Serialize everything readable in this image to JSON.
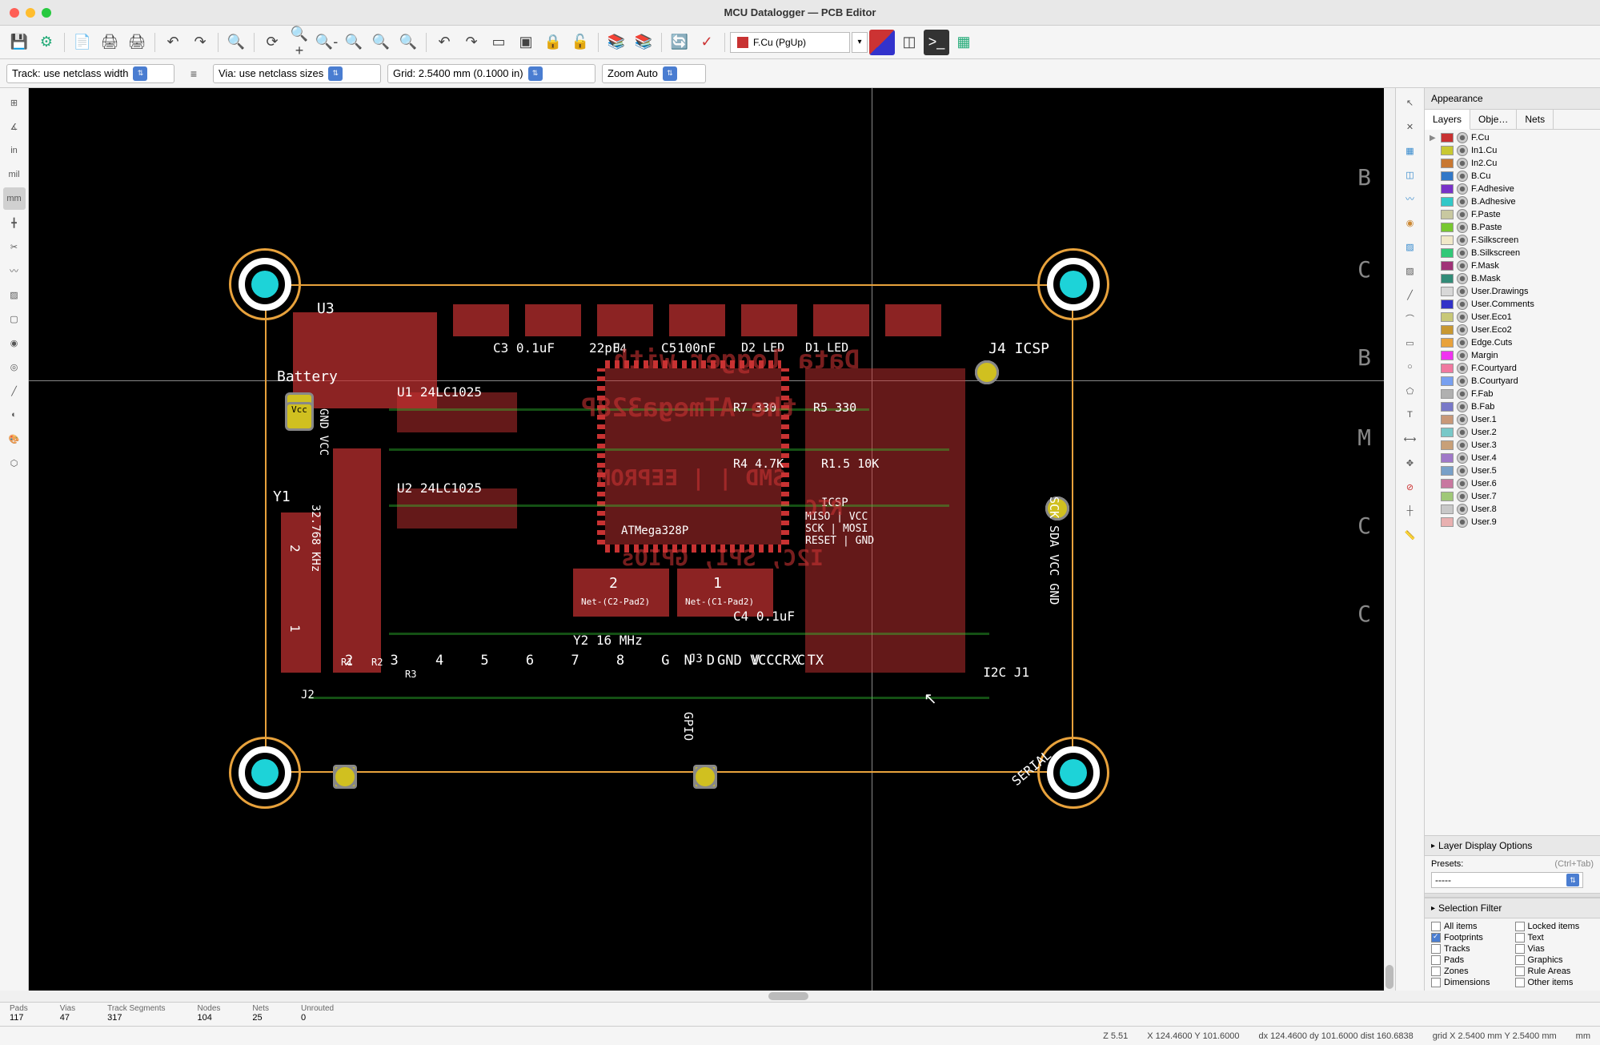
{
  "window": {
    "title": "MCU Datalogger — PCB Editor"
  },
  "toolbar": {
    "layer_selector": "F.Cu (PgUp)"
  },
  "toolbar2": {
    "track": "Track: use netclass width",
    "via": "Via: use netclass sizes",
    "grid": "Grid: 2.5400 mm (0.1000 in)",
    "zoom": "Zoom Auto"
  },
  "left_toolbar": {
    "units_in": "in",
    "units_mil": "mil",
    "units_mm": "mm"
  },
  "appearance": {
    "title": "Appearance",
    "tabs": [
      "Layers",
      "Obje…",
      "Nets"
    ],
    "layers": [
      {
        "name": "F.Cu",
        "color": "#c83232",
        "arrow": true
      },
      {
        "name": "In1.Cu",
        "color": "#c8c832"
      },
      {
        "name": "In2.Cu",
        "color": "#c87832"
      },
      {
        "name": "B.Cu",
        "color": "#3278c8"
      },
      {
        "name": "F.Adhesive",
        "color": "#7832c8"
      },
      {
        "name": "B.Adhesive",
        "color": "#32c8c8"
      },
      {
        "name": "F.Paste",
        "color": "#c8c8a0"
      },
      {
        "name": "B.Paste",
        "color": "#78c832"
      },
      {
        "name": "F.Silkscreen",
        "color": "#f0e8c8"
      },
      {
        "name": "B.Silkscreen",
        "color": "#32c878"
      },
      {
        "name": "F.Mask",
        "color": "#a03278"
      },
      {
        "name": "B.Mask",
        "color": "#328c78"
      },
      {
        "name": "User.Drawings",
        "color": "#d8d8d8"
      },
      {
        "name": "User.Comments",
        "color": "#3232c8"
      },
      {
        "name": "User.Eco1",
        "color": "#c8c878"
      },
      {
        "name": "User.Eco2",
        "color": "#c89832"
      },
      {
        "name": "Edge.Cuts",
        "color": "#e8a23c"
      },
      {
        "name": "Margin",
        "color": "#f032f0"
      },
      {
        "name": "F.Courtyard",
        "color": "#f078a0"
      },
      {
        "name": "B.Courtyard",
        "color": "#78a0f0"
      },
      {
        "name": "F.Fab",
        "color": "#b0b0b0"
      },
      {
        "name": "B.Fab",
        "color": "#7878c8"
      },
      {
        "name": "User.1",
        "color": "#c89878"
      },
      {
        "name": "User.2",
        "color": "#78c8c8"
      },
      {
        "name": "User.3",
        "color": "#c8a078"
      },
      {
        "name": "User.4",
        "color": "#a078c8"
      },
      {
        "name": "User.5",
        "color": "#78a0c8"
      },
      {
        "name": "User.6",
        "color": "#c878a0"
      },
      {
        "name": "User.7",
        "color": "#a0c878"
      },
      {
        "name": "User.8",
        "color": "#c8c8c8"
      },
      {
        "name": "User.9",
        "color": "#e8b0b0"
      }
    ],
    "layer_display_options": "Layer Display Options",
    "presets_label": "Presets:",
    "presets_hint": "(Ctrl+Tab)",
    "presets_value": "-----",
    "selection_filter": "Selection Filter",
    "filters": [
      {
        "label": "All items",
        "checked": false
      },
      {
        "label": "Locked items",
        "checked": false
      },
      {
        "label": "Footprints",
        "checked": true
      },
      {
        "label": "Text",
        "checked": false
      },
      {
        "label": "Tracks",
        "checked": false
      },
      {
        "label": "Vias",
        "checked": false
      },
      {
        "label": "Pads",
        "checked": false
      },
      {
        "label": "Graphics",
        "checked": false
      },
      {
        "label": "Zones",
        "checked": false
      },
      {
        "label": "Rule Areas",
        "checked": false
      },
      {
        "label": "Dimensions",
        "checked": false
      },
      {
        "label": "Other items",
        "checked": false
      }
    ]
  },
  "pcb": {
    "silk": {
      "battery": "Battery",
      "u3": "U3",
      "u4": "U4",
      "u2": "U2  24LC1025",
      "u1": "U1  24LC1025",
      "y1": "Y1",
      "y2": "Y2     16 MHz",
      "khz": "32.768 KHz",
      "c3": "C3 0.1uF",
      "c4_22": "22pF",
      "c5": "C5",
      "c100": "100nF",
      "d2": "D2 LED",
      "d1": "D1 LED",
      "j4_icsp": "J4  ICSP",
      "gnd_vcc1": "GND VCC",
      "r1": "R1",
      "r2": "R2",
      "r3": "R3",
      "r7": "R7 330",
      "r5": "R5 330",
      "r4": "R4 4.7K",
      "r10": "R1.5 10K",
      "c4": "C4 0.1uF",
      "icsp_labels": "ICSP",
      "miso_vcc": "MISO | VCC",
      "sck_mosi": "SCK | MOSI",
      "reset_gnd": "RESET | GND",
      "j2": "J2",
      "j3": "J3",
      "j1_i2c": "I2C J1",
      "serial": "SERIAL",
      "gpio": "GPIO",
      "pins": "2  3  4  5  6  7  8  GND VCC",
      "gnd_vcc_rx": "GND VCC  RX    TX",
      "sck_sda": "SCK SDA VCC GND",
      "vcc_pad": "Vcc",
      "net_c1": "Net-(C1-Pad2)",
      "net_c2": "Net-(C2-Pad2)",
      "pad_1": "1",
      "pad_2": "2",
      "atmega": "ATMega328P"
    },
    "edge_refs": [
      "B",
      "C",
      "B",
      "M",
      "C",
      "C"
    ],
    "overlay_text1": "Data logger with",
    "overlay_text2": "the ATmega328P",
    "overlay_text3": "SMD | | EEPROM",
    "overlay_text4": "I2C, SPI, GPIOs",
    "overlay_text5": "RTC"
  },
  "status1": {
    "pads_label": "Pads",
    "pads_val": "117",
    "vias_label": "Vias",
    "vias_val": "47",
    "tracks_label": "Track Segments",
    "tracks_val": "317",
    "nodes_label": "Nodes",
    "nodes_val": "104",
    "nets_label": "Nets",
    "nets_val": "25",
    "unrouted_label": "Unrouted",
    "unrouted_val": "0"
  },
  "status2": {
    "z": "Z 5.51",
    "xy": "X 124.4600  Y 101.6000",
    "dxy": "dx 124.4600  dy 101.6000  dist 160.6838",
    "grid": "grid X 2.5400 mm  Y 2.5400 mm",
    "unit": "mm"
  }
}
